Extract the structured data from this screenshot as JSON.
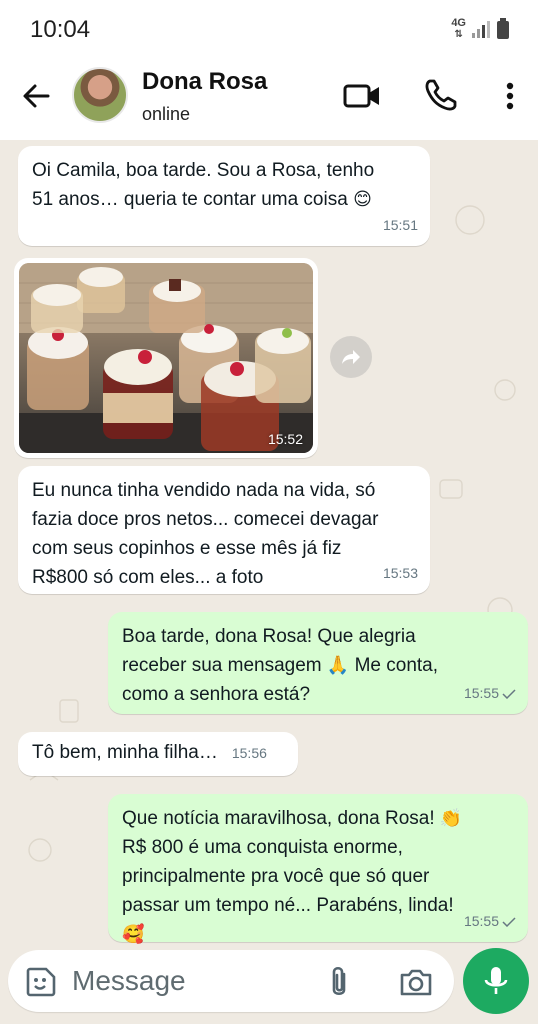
{
  "status_bar": {
    "time": "10:04",
    "network": "4G"
  },
  "header": {
    "contact_name": "Dona Rosa",
    "contact_status": "online"
  },
  "messages": [
    {
      "direction": "incoming",
      "lines": [
        "Oi Camila, boa tarde. Sou a Rosa, tenho",
        "51 anos… queria te contar uma coisa"
      ],
      "emoji": "😊",
      "time": "15:51"
    },
    {
      "direction": "incoming",
      "type": "photo",
      "time": "15:52"
    },
    {
      "direction": "incoming",
      "lines": [
        "Eu nunca tinha vendido nada na vida, só",
        "fazia doce pros netos... comecei devagar",
        "com seus copinhos e esse mês já fiz",
        "R$800 só com eles... a foto"
      ],
      "time": "15:53"
    },
    {
      "direction": "outgoing",
      "lines": [
        "Boa tarde, dona Rosa! Que alegria",
        "receber sua mensagem",
        "Me conta,",
        "como a senhora está?"
      ],
      "emoji": "🙏",
      "time": "15:55"
    },
    {
      "direction": "incoming",
      "text": "Tô bem, minha filha…",
      "time": "15:56"
    },
    {
      "direction": "outgoing",
      "lines": [
        "Que notícia maravilhosa, dona Rosa!",
        "R$ 800 é uma conquista enorme,",
        "principalmente pra você que só quer",
        "passar um tempo né... Parabéns, linda!"
      ],
      "emoji_1": "👏",
      "emoji_2": "🥰",
      "time": "15:55"
    }
  ],
  "composer": {
    "placeholder": "Message"
  },
  "colors": {
    "incoming_bubble": "#ffffff",
    "outgoing_bubble": "#d9fdd3",
    "accent": "#1daa61",
    "chat_background": "#efeae2"
  },
  "icons": [
    "arrow-back-icon",
    "video-call-icon",
    "phone-icon",
    "more-vert-icon",
    "forward-icon",
    "sticker-icon",
    "attach-icon",
    "camera-icon",
    "mic-icon",
    "double-check-icon"
  ]
}
